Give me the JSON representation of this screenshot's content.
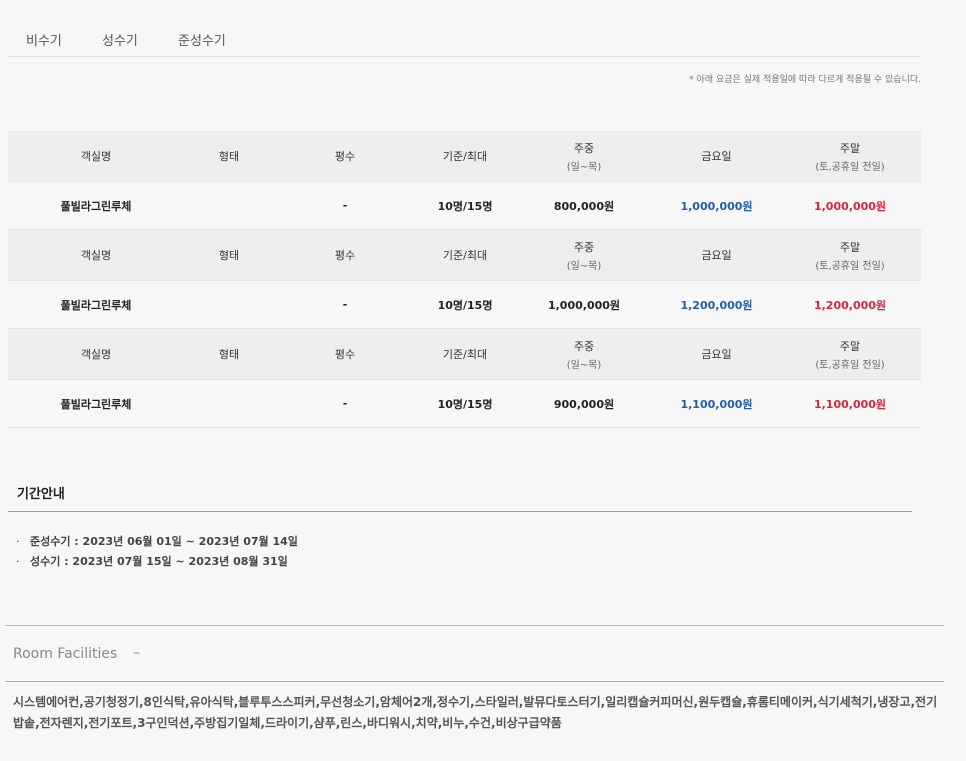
{
  "tabs": [
    "비수기",
    "성수기",
    "준성수기"
  ],
  "notice": "* 아래 요금은 실제 적용일에 따라 다르게 적용될 수 있습니다.",
  "table": {
    "headers": {
      "room": "객실명",
      "type": "형태",
      "size": "평수",
      "capacity": "기준/최대",
      "weekday": "주중",
      "weekday_sub": "(일~목)",
      "friday": "금요일",
      "weekend": "주말",
      "weekend_sub": "(토,공휴일 전일)"
    },
    "rows": [
      {
        "room": "풀빌라그린루체",
        "type": "",
        "size": "-",
        "capacity": "10명/15명",
        "weekday": "800,000원",
        "friday": "1,000,000원",
        "weekend": "1,000,000원"
      },
      {
        "room": "풀빌라그린루체",
        "type": "",
        "size": "-",
        "capacity": "10명/15명",
        "weekday": "1,000,000원",
        "friday": "1,200,000원",
        "weekend": "1,200,000원"
      },
      {
        "room": "풀빌라그린루체",
        "type": "",
        "size": "-",
        "capacity": "10명/15명",
        "weekday": "900,000원",
        "friday": "1,100,000원",
        "weekend": "1,100,000원"
      }
    ]
  },
  "period_title": "기간안내",
  "periods": [
    "준성수기 : 2023년 06월 01일 ~ 2023년 07월 14일",
    "성수기 : 2023년 07월 15일 ~ 2023년 08월 31일"
  ],
  "period_bullet": "·",
  "facilities": {
    "title": "Room Facilities",
    "dash": "–",
    "text": "시스템에어컨,공기청정기,8인식탁,유아식탁,블루투스스피커,무선청소기,암체어2개,정수기,스타일러,발뮤다토스터기,일리캡슐커피머신,원두캡슐,휴롬티메이커,식기세척기,냉장고,전기밥솥,전자렌지,전기포트,3구인덕션,주방집기일체,드라이기,샴푸,린스,바디워시,치약,비누,수건,비상구급약품"
  },
  "colors": {
    "friday": "#1f5ea8",
    "weekend": "#d9243a"
  }
}
